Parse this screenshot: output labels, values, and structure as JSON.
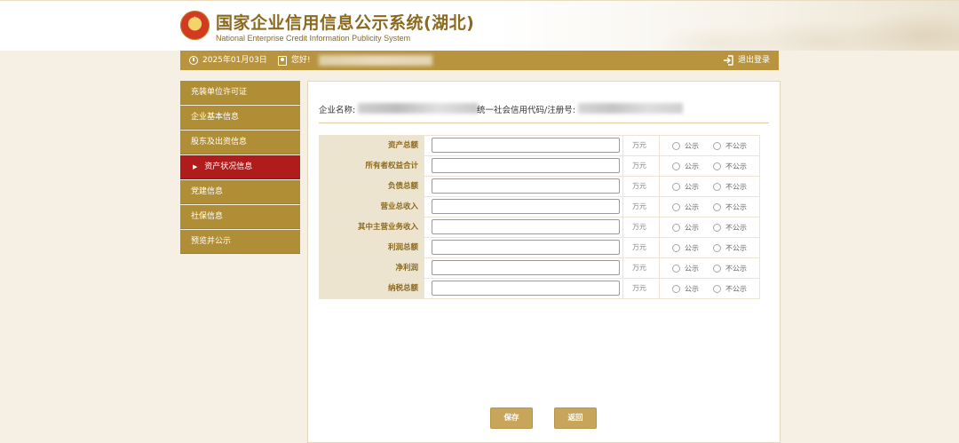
{
  "header": {
    "title": "国家企业信用信息公示系统(湖北)",
    "subtitle": "National Enterprise Credit Information Publicity System"
  },
  "topbar": {
    "date": "2025年01月03日",
    "greeting": "您好!",
    "logout_label": "退出登录",
    "icons": {
      "date": "clock-icon",
      "user": "user-icon",
      "logout": "logout-icon"
    }
  },
  "sidebar": {
    "items": [
      {
        "label": "充装单位许可证",
        "active": false
      },
      {
        "label": "企业基本信息",
        "active": false
      },
      {
        "label": "股东及出资信息",
        "active": false
      },
      {
        "label": "资产状况信息",
        "active": true
      },
      {
        "label": "党建信息",
        "active": false
      },
      {
        "label": "社保信息",
        "active": false
      },
      {
        "label": "预览并公示",
        "active": false
      }
    ]
  },
  "info": {
    "company_name_label": "企业名称:",
    "credit_code_label": "统一社会信用代码/注册号:"
  },
  "form": {
    "unit": "万元",
    "public_label": "公示",
    "not_public_label": "不公示",
    "rows": [
      {
        "label": "资产总额",
        "value": ""
      },
      {
        "label": "所有者权益合计",
        "value": ""
      },
      {
        "label": "负债总额",
        "value": ""
      },
      {
        "label": "营业总收入",
        "value": ""
      },
      {
        "label": "其中主营业务收入",
        "value": ""
      },
      {
        "label": "利润总额",
        "value": ""
      },
      {
        "label": "净利润",
        "value": ""
      },
      {
        "label": "纳税总额",
        "value": ""
      }
    ]
  },
  "buttons": {
    "save_label": "保存",
    "back_label": "返回"
  },
  "colors": {
    "accent_gold": "#b8943f",
    "active_red": "#b01c1c",
    "button_gold": "#c7a55a"
  }
}
